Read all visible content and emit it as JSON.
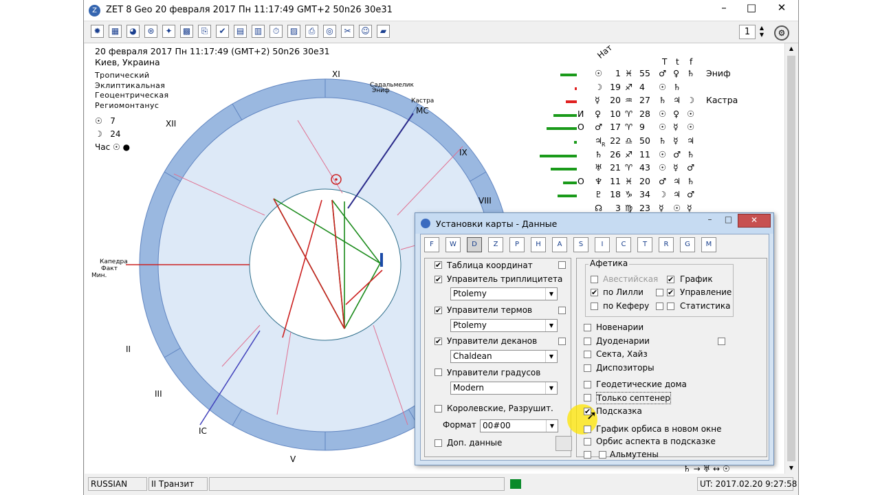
{
  "window": {
    "title": "ZET 8 Geo   20 февраля 2017   Пн   11:17:49 GMT+2 50n26  30e31"
  },
  "toolbar": {
    "icons": [
      "alert-icon",
      "table-icon",
      "moon-icon",
      "wheel-icon",
      "stars-icon",
      "grid-icon",
      "copy-icon",
      "check-icon",
      "book-icon",
      "calendar-icon",
      "clock-icon",
      "map-icon",
      "print-icon",
      "target-icon",
      "tools-icon",
      "person-icon",
      "graph-icon"
    ],
    "spinner_value": "1"
  },
  "chart": {
    "date_line": "20 февраля 2017   Пн   11:17:49 (GMT+2) 50n26  30e31",
    "place": "Киев, Украина",
    "systems": [
      "Тропический",
      "Эклиптикальная",
      "Геоцентрическая",
      "Региомонтанус"
    ],
    "sun_value": "7",
    "moon_value": "24",
    "hour_label": "Час",
    "house_labels": [
      "XI",
      "XII",
      "IX",
      "VIII",
      "II",
      "III",
      "IC",
      "V",
      "MC"
    ],
    "stars": [
      "Садальмелик",
      "Эниф",
      "Кастра"
    ],
    "left_labels": [
      "Капедра",
      "Факт",
      "Мин."
    ]
  },
  "planet_table": {
    "head_nat": "Нат",
    "cols": [
      "T",
      "t",
      "f"
    ],
    "rows": [
      {
        "glyph": "☉",
        "deg": "1",
        "sign": "♓",
        "min": "55",
        "c1": "♂",
        "c2": "♀",
        "c3": "♄",
        "star": "Эниф",
        "bar": 24,
        "prefix": ""
      },
      {
        "glyph": "☽",
        "deg": "19",
        "sign": "♐",
        "min": "4",
        "c1": "☉",
        "c2": "♄",
        "c3": "",
        "star": "",
        "bar": 3,
        "prefix": "",
        "red": true
      },
      {
        "glyph": "☿",
        "deg": "20",
        "sign": "♒",
        "min": "27",
        "c1": "♄",
        "c2": "♃",
        "c3": "☽",
        "star": "Кастра",
        "bar": 16,
        "prefix": "",
        "red": true
      },
      {
        "glyph": "♀",
        "deg": "10",
        "sign": "♈",
        "min": "28",
        "c1": "☉",
        "c2": "♀",
        "c3": "☉",
        "star": "",
        "bar": 34,
        "prefix": "И"
      },
      {
        "glyph": "♂",
        "deg": "17",
        "sign": "♈",
        "min": "9",
        "c1": "☉",
        "c2": "☿",
        "c3": "☉",
        "star": "",
        "bar": 44,
        "prefix": "О"
      },
      {
        "glyph": "♃",
        "deg": "22",
        "sign": "♎",
        "min": "50",
        "c1": "♄",
        "c2": "☿",
        "c3": "♃",
        "star": "",
        "bar": 4,
        "prefix": "",
        "sub": "R"
      },
      {
        "glyph": "♄",
        "deg": "26",
        "sign": "♐",
        "min": "11",
        "c1": "☉",
        "c2": "♂",
        "c3": "♄",
        "star": "",
        "bar": 54,
        "prefix": ""
      },
      {
        "glyph": "♅",
        "deg": "21",
        "sign": "♈",
        "min": "43",
        "c1": "☉",
        "c2": "☿",
        "c3": "♂",
        "star": "",
        "bar": 38,
        "prefix": ""
      },
      {
        "glyph": "♆",
        "deg": "11",
        "sign": "♓",
        "min": "20",
        "c1": "♂",
        "c2": "♃",
        "c3": "♄",
        "star": "",
        "bar": 20,
        "prefix": "О"
      },
      {
        "glyph": "♇",
        "deg": "18",
        "sign": "♑",
        "min": "34",
        "c1": "☽",
        "c2": "♃",
        "c3": "♂",
        "star": "",
        "bar": 28,
        "prefix": ""
      },
      {
        "glyph": "☊",
        "deg": "3",
        "sign": "♍",
        "min": "23",
        "c1": "☿",
        "c2": "☉",
        "c3": "☿",
        "star": "",
        "bar": 0,
        "prefix": ""
      }
    ]
  },
  "dialog": {
    "title": "Установки карты - Данные",
    "tabs": [
      "F",
      "W",
      "D",
      "Z",
      "P",
      "H",
      "A",
      "S",
      "I",
      "C",
      "T",
      "R",
      "G",
      "M"
    ],
    "left": {
      "coords_table": "Таблица координат",
      "triplicity": "Управитель триплицитета",
      "triplicity_value": "Ptolemy",
      "terms": "Управители термов",
      "terms_value": "Ptolemy",
      "decans": "Управители деканов",
      "decans_value": "Chaldean",
      "degrees": "Управители градусов",
      "degrees_value": "Modern",
      "royal": "Королевские, Разрушит.",
      "format_label": "Формат",
      "format_value": "00#00",
      "extra": "Доп. данные"
    },
    "right": {
      "group_label": "Афетика",
      "avestian": "Авестийская",
      "lilly": "по Лилли",
      "kepler": "по Кеферу",
      "graph": "График",
      "control": "Управление",
      "stats": "Статистика",
      "novenaria": "Новенарии",
      "duodenaria": "Дуоденарии",
      "sect": "Секта, Хайз",
      "dispositors": "Диспозиторы",
      "geodetic": "Геодетические дома",
      "septener": "Только септенер",
      "hint": "Подсказка",
      "orbis_window": "График орбиса в новом окне",
      "orbis_hint": "Орбис аспекта в подсказке",
      "almutens": "Альмутены"
    }
  },
  "status": {
    "lang": "RUSSIAN",
    "mode": "II Транзит",
    "ut": "UT: 2017.02.20  9:27:58"
  },
  "bottom_icons": "♄ → ♅ ↔ ☉"
}
